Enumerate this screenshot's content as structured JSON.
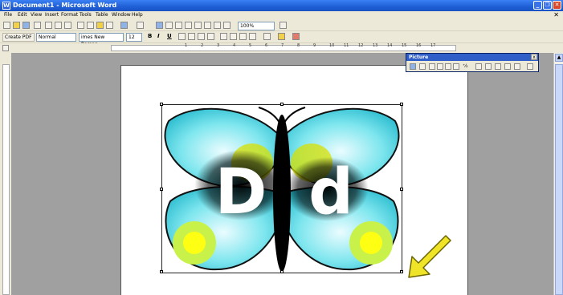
{
  "window": {
    "title": "Document1 - Microsoft Word",
    "app_icon": "W"
  },
  "menu": [
    "File",
    "Edit",
    "View",
    "Insert",
    "Format",
    "Tools",
    "Table",
    "Window",
    "Help"
  ],
  "toolbar": {
    "zoom": "100%",
    "create_pdf": "Create PDF",
    "style": "Normal",
    "font": "imes New Roman",
    "size": "12"
  },
  "ruler_numbers": [
    "1",
    "2",
    "3",
    "4",
    "5",
    "6",
    "7",
    "8",
    "9",
    "10",
    "11",
    "12",
    "13",
    "14",
    "15",
    "16",
    "17"
  ],
  "picture_toolbar": {
    "title": "Picture",
    "ab_label": "⁺⁄₂"
  },
  "image": {
    "left_letter": "D",
    "right_letter": "d"
  },
  "colors": {
    "wing": "#38c9d9",
    "wing_light": "#d8f8fb",
    "dot_outer": "#c8f24a",
    "dot_inner": "#ffff14",
    "arrow": "#f0e428"
  }
}
